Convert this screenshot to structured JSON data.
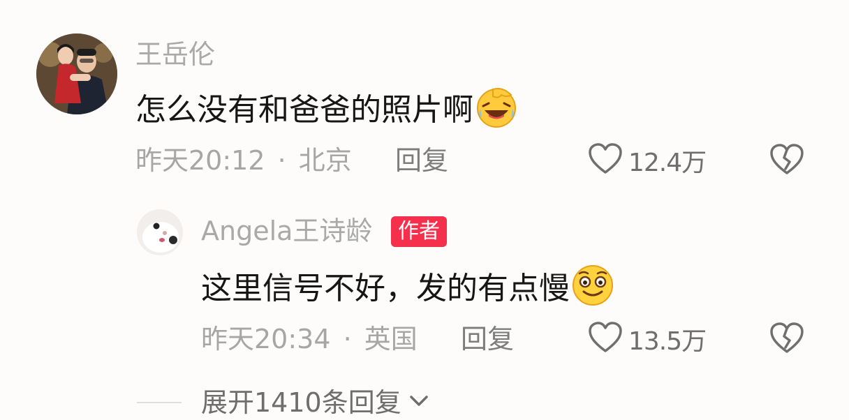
{
  "comments": [
    {
      "username": "王岳伦",
      "text": "怎么没有和爸爸的照片啊",
      "emoji": "laughing-crying-face-icon",
      "time": "昨天20:12",
      "location": "北京",
      "reply_label": "回复",
      "likes": "12.4万",
      "reply": {
        "username": "Angela王诗龄",
        "badge": "作者",
        "text": "这里信号不好，发的有点慢",
        "emoji": "smiling-face-icon",
        "time": "昨天20:34",
        "location": "英国",
        "reply_label": "回复",
        "likes": "13.5万"
      },
      "expand_label": "展开1410条回复"
    }
  ],
  "colors": {
    "badge": "#f4304d",
    "text": "#161616",
    "meta": "#a6a6a6"
  }
}
